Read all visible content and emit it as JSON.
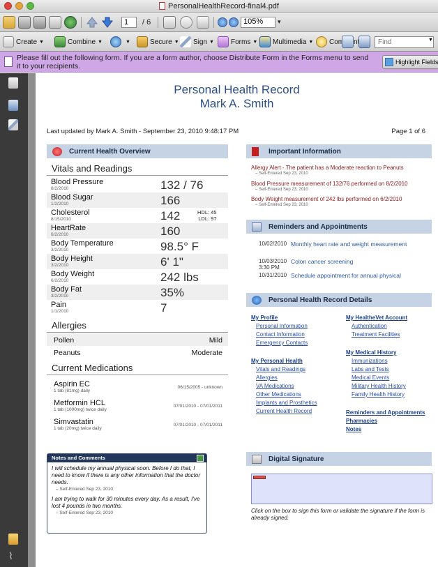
{
  "window": {
    "title": "PersonalHealthRecord-final4.pdf"
  },
  "toolbar": {
    "page_current": "1",
    "page_total": "/ 6",
    "zoom": "105%",
    "create": "Create",
    "combine": "Combine",
    "secure": "Secure",
    "sign": "Sign",
    "forms": "Forms",
    "multimedia": "Multimedia",
    "comment": "Comment",
    "find_placeholder": "Find"
  },
  "forms_banner": {
    "text": "Please fill out the following form. If you are a form author, choose Distribute Form in the Forms menu to send it to your recipients.",
    "highlight_button": "Highlight Fields"
  },
  "document": {
    "title": "Personal Health Record",
    "name": "Mark A. Smith",
    "last_updated": "Last updated by Mark A. Smith - September 23, 2010 9:48:17 PM",
    "page_of": "Page 1 of 6",
    "overview": {
      "heading": "Current Health Overview",
      "vitals_heading": "Vitals and Readings",
      "vitals": [
        {
          "name": "Blood Pressure",
          "date": "8/2/2010",
          "value": "132 / 76"
        },
        {
          "name": "Blood Sugar",
          "date": "1/2/2010",
          "value": "166"
        },
        {
          "name": "Cholesterol",
          "date": "8/15/2010",
          "value": "142",
          "hdl": "HDL: 45",
          "ldl": "LDL: 97"
        },
        {
          "name": "HeartRate",
          "date": "6/2/2010",
          "value": "160"
        },
        {
          "name": "Body Temperature",
          "date": "3/2/2010",
          "value": "98.5° F"
        },
        {
          "name": "Body Height",
          "date": "3/2/2010",
          "value": "6' 1\""
        },
        {
          "name": "Body Weight",
          "date": "6/2/2010",
          "value": "242 lbs"
        },
        {
          "name": "Body Fat",
          "date": "3/2/2010",
          "value": "35%"
        },
        {
          "name": "Pain",
          "date": "1/1/2010",
          "value": "7"
        }
      ],
      "allergies_heading": "Allergies",
      "allergies": [
        {
          "name": "Pollen",
          "severity": "Mild"
        },
        {
          "name": "Peanuts",
          "severity": "Moderate"
        }
      ],
      "medications_heading": "Current Medications",
      "medications": [
        {
          "name": "Aspirin EC",
          "dose": "1 tab (81mg) daily",
          "dates": "06/15/2005 - unknown"
        },
        {
          "name": "Metformin HCL",
          "dose": "1 tab (1000mg) twice daily",
          "dates": "07/01/2010 - 07/01/2011"
        },
        {
          "name": "Simvastatin",
          "dose": "1 tab (20mg) twice daily",
          "dates": "07/01/2010 - 07/01/2011"
        }
      ]
    },
    "notes": {
      "heading": "Notes and Comments",
      "items": [
        {
          "text": "I will schedule my annual physical soon. Before I do that, I need to know if there is any other information that the doctor needs.",
          "meta": "– Self-Entered  Sep 23, 2010"
        },
        {
          "text": "I am trying to walk for 30 minutes every day. As a result, I've lost 4 pounds in two months.",
          "meta": "– Self-Entered  Sep 23, 2010"
        }
      ]
    },
    "important": {
      "heading": "Important Information",
      "items": [
        {
          "text": "Allergy Alert - The patient has a Moderate reaction to Peanuts",
          "meta": "– Self-Entered  Sep 23, 2010"
        },
        {
          "text": "Blood Pressure measurement of 132/76 performed on 8/2/2010",
          "meta": "– Self-Entered  Sep 23, 2010"
        },
        {
          "text": "Body Weight measurement of 242 lbs performed on 6/2/2010",
          "meta": "– Self-Entered  Sep 23, 2010"
        }
      ]
    },
    "reminders": {
      "heading": "Reminders and Appointments",
      "items": [
        {
          "date": "10/02/2010",
          "time": "",
          "desc": "Monthly heart rate and weight measurement"
        },
        {
          "date": "10/03/2010",
          "time": "3:30 PM",
          "desc": "Colon cancer screening"
        },
        {
          "date": "10/31/2010",
          "time": "",
          "desc": "Schedule appointment for annual physical"
        }
      ]
    },
    "details": {
      "heading": "Personal Health Record Details",
      "my_profile": "My Profile",
      "profile_links": [
        "Personal Information",
        "Contact Information",
        "Emergency Contacts"
      ],
      "my_personal_health": "My Personal Health",
      "health_links": [
        "Vitals and Readings",
        "Allergies",
        "VA Medications",
        "Other Medications",
        "Implants and Prosthetics",
        "Current Health Record"
      ],
      "my_healthevet": "My HealtheVet Account",
      "account_links": [
        "Authentication",
        "Treatment Facilities"
      ],
      "my_medical_history": "My Medical History",
      "history_links": [
        "Immunizations",
        "Labs and Tests",
        "Medical Events",
        "Military Health History",
        "Family Health History"
      ],
      "reminders_link": "Reminders and Appointments",
      "pharmacies_link": "Pharmacies",
      "notes_link": "Notes"
    },
    "signature": {
      "heading": "Digital Signature",
      "help": "Click on the box to sign this form or validate the signature if the form is already signed."
    }
  },
  "colors": {
    "section_header_bg": "#c5d3e4",
    "title_blue": "#2d4f85",
    "alert_red": "#8a1a1a",
    "link_blue": "#2c4ea8",
    "banner_purple": "#cfa6e6"
  }
}
